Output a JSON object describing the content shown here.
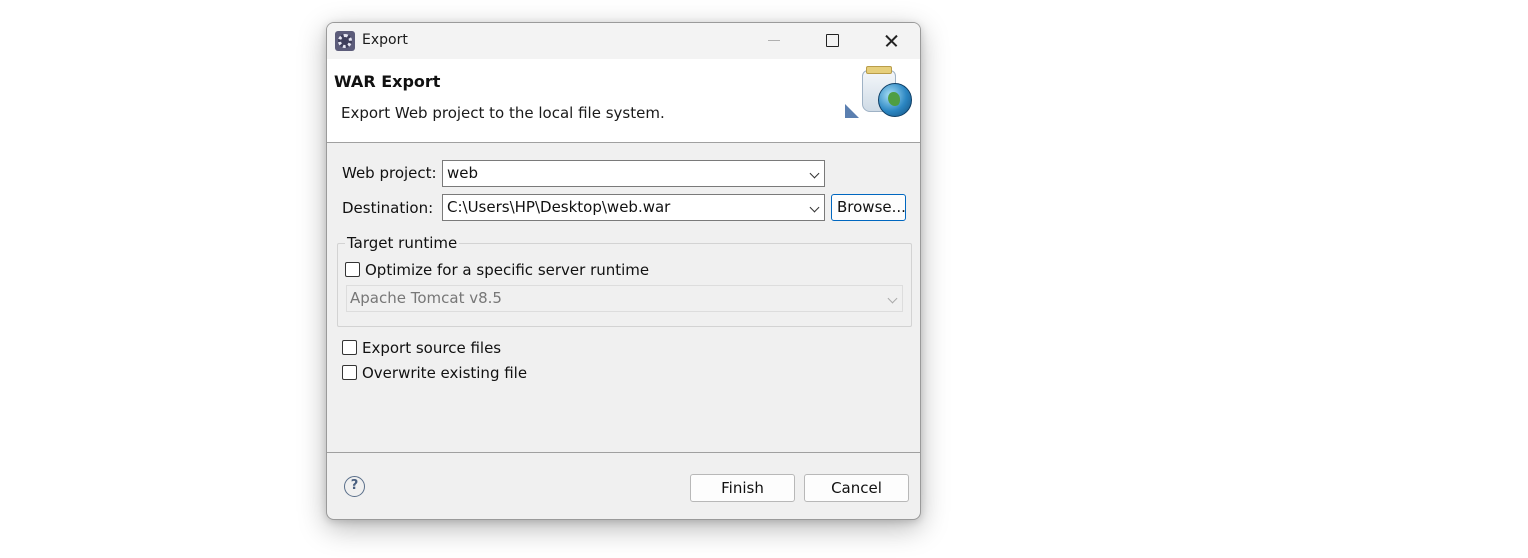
{
  "window": {
    "title": "Export",
    "app_icon": "eclipse-gear-icon"
  },
  "header": {
    "title": "WAR Export",
    "description": "Export Web project to the local file system.",
    "banner_icon": "war-export-wizard-icon"
  },
  "form": {
    "web_project_label": "Web project:",
    "web_project_value": "web",
    "destination_label": "Destination:",
    "destination_value": "C:\\Users\\HP\\Desktop\\web.war",
    "browse_label": "Browse..."
  },
  "target_runtime": {
    "group_title": "Target runtime",
    "optimize_label": "Optimize for a specific server runtime",
    "optimize_checked": false,
    "runtime_value": "Apache Tomcat v8.5",
    "runtime_enabled": false
  },
  "options": {
    "export_source_label": "Export source files",
    "export_source_checked": false,
    "overwrite_label": "Overwrite existing file",
    "overwrite_checked": false
  },
  "footer": {
    "help_icon": "question-mark-icon",
    "finish_label": "Finish",
    "cancel_label": "Cancel"
  }
}
